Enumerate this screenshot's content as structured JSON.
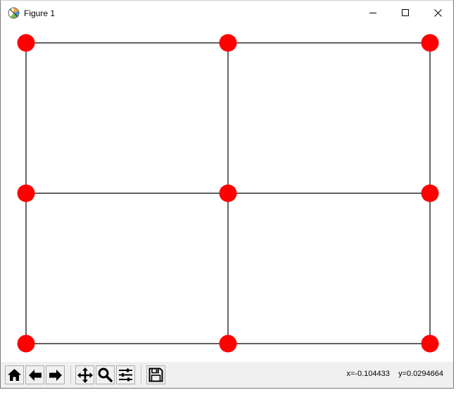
{
  "window": {
    "title": "Figure 1"
  },
  "icons": {
    "app": "matplotlib-figure-icon",
    "minimize": "minimize-icon",
    "maximize": "maximize-icon",
    "close": "close-icon",
    "home": "home-icon",
    "back": "arrow-left-icon",
    "forward": "arrow-right-icon",
    "pan": "move-arrows-icon",
    "zoom": "magnifier-icon",
    "configure": "sliders-icon",
    "save": "floppy-disk-icon"
  },
  "toolbar": {
    "coords_text": "x=-0.104433    y=0.0294664"
  },
  "colors": {
    "node": "#ff0000",
    "edge": "#000000",
    "toolbar_bg": "#f0f0f0"
  },
  "chart_data": {
    "type": "scatter",
    "xlim": [
      0,
      2
    ],
    "ylim": [
      0,
      2
    ],
    "grid": false,
    "nodes": [
      {
        "x": 0,
        "y": 2
      },
      {
        "x": 1,
        "y": 2
      },
      {
        "x": 2,
        "y": 2
      },
      {
        "x": 0,
        "y": 1
      },
      {
        "x": 1,
        "y": 1
      },
      {
        "x": 2,
        "y": 1
      },
      {
        "x": 0,
        "y": 0
      },
      {
        "x": 1,
        "y": 0
      },
      {
        "x": 2,
        "y": 0
      }
    ],
    "edges": [
      [
        0,
        1
      ],
      [
        1,
        2
      ],
      [
        3,
        4
      ],
      [
        4,
        5
      ],
      [
        6,
        7
      ],
      [
        7,
        8
      ],
      [
        0,
        3
      ],
      [
        3,
        6
      ],
      [
        1,
        4
      ],
      [
        4,
        7
      ],
      [
        2,
        5
      ],
      [
        5,
        8
      ]
    ]
  }
}
